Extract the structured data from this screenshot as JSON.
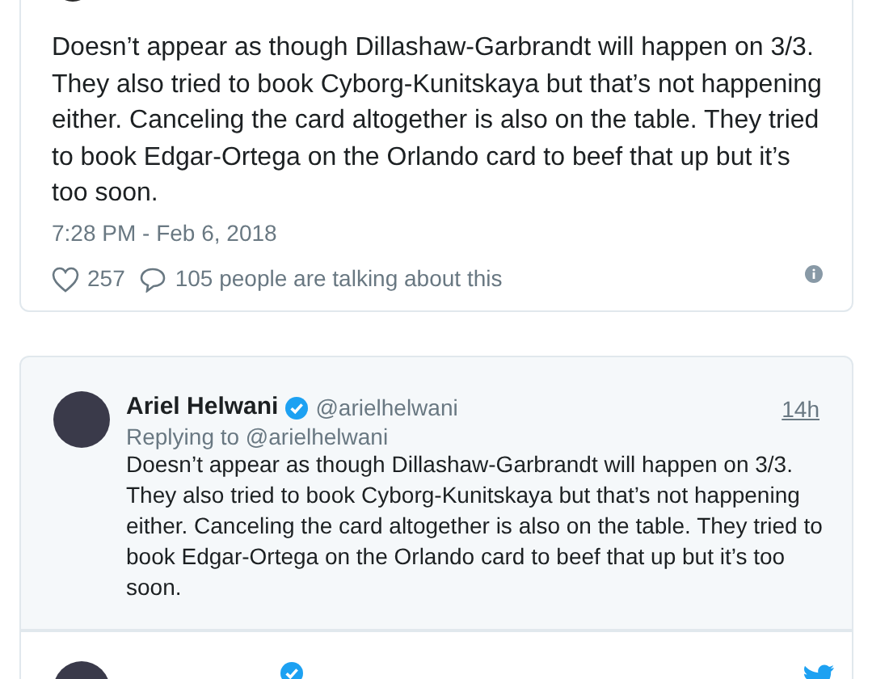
{
  "main_tweet": {
    "text": "Doesn’t appear as though Dillashaw-Garbrandt will happen on 3/3. They also tried to book Cyborg-Kunitskaya but that’s not happening either. Canceling the card altogether is also on the table. They tried to book Edgar-Ortega on the Orlando card to beef that up but it’s too soon.",
    "timestamp": "7:28 PM - Feb 6, 2018",
    "likes": "257",
    "talking": "105 people are talking about this"
  },
  "quoted_tweet": {
    "name": "Ariel Helwani",
    "verified": true,
    "handle": "@arielhelwani",
    "time": "14h",
    "replying_to": "Replying to @arielhelwani",
    "text": "Doesn’t appear as though Dillashaw-Garbrandt will happen on 3/3. They also tried to book Cyborg-Kunitskaya but that’s not happening either. Canceling the card altogether is also on the table. They tried to book Edgar-Ortega on the Orlando card to beef that up but it’s too soon."
  },
  "next_tweet": {
    "verified": true
  }
}
